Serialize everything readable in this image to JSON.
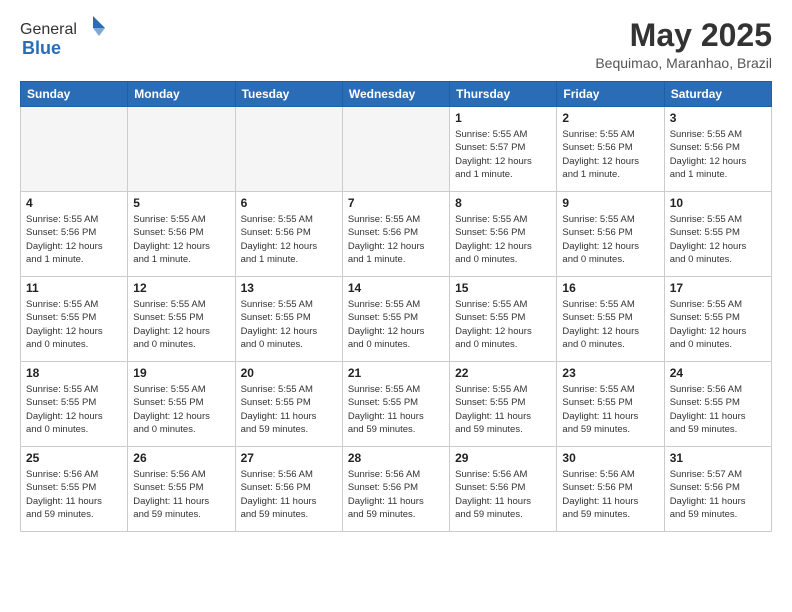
{
  "header": {
    "logo_general": "General",
    "logo_blue": "Blue",
    "title": "May 2025",
    "location": "Bequimao, Maranhao, Brazil"
  },
  "weekdays": [
    "Sunday",
    "Monday",
    "Tuesday",
    "Wednesday",
    "Thursday",
    "Friday",
    "Saturday"
  ],
  "weeks": [
    [
      {
        "day": "",
        "info": ""
      },
      {
        "day": "",
        "info": ""
      },
      {
        "day": "",
        "info": ""
      },
      {
        "day": "",
        "info": ""
      },
      {
        "day": "1",
        "info": "Sunrise: 5:55 AM\nSunset: 5:57 PM\nDaylight: 12 hours\nand 1 minute."
      },
      {
        "day": "2",
        "info": "Sunrise: 5:55 AM\nSunset: 5:56 PM\nDaylight: 12 hours\nand 1 minute."
      },
      {
        "day": "3",
        "info": "Sunrise: 5:55 AM\nSunset: 5:56 PM\nDaylight: 12 hours\nand 1 minute."
      }
    ],
    [
      {
        "day": "4",
        "info": "Sunrise: 5:55 AM\nSunset: 5:56 PM\nDaylight: 12 hours\nand 1 minute."
      },
      {
        "day": "5",
        "info": "Sunrise: 5:55 AM\nSunset: 5:56 PM\nDaylight: 12 hours\nand 1 minute."
      },
      {
        "day": "6",
        "info": "Sunrise: 5:55 AM\nSunset: 5:56 PM\nDaylight: 12 hours\nand 1 minute."
      },
      {
        "day": "7",
        "info": "Sunrise: 5:55 AM\nSunset: 5:56 PM\nDaylight: 12 hours\nand 1 minute."
      },
      {
        "day": "8",
        "info": "Sunrise: 5:55 AM\nSunset: 5:56 PM\nDaylight: 12 hours\nand 0 minutes."
      },
      {
        "day": "9",
        "info": "Sunrise: 5:55 AM\nSunset: 5:56 PM\nDaylight: 12 hours\nand 0 minutes."
      },
      {
        "day": "10",
        "info": "Sunrise: 5:55 AM\nSunset: 5:55 PM\nDaylight: 12 hours\nand 0 minutes."
      }
    ],
    [
      {
        "day": "11",
        "info": "Sunrise: 5:55 AM\nSunset: 5:55 PM\nDaylight: 12 hours\nand 0 minutes."
      },
      {
        "day": "12",
        "info": "Sunrise: 5:55 AM\nSunset: 5:55 PM\nDaylight: 12 hours\nand 0 minutes."
      },
      {
        "day": "13",
        "info": "Sunrise: 5:55 AM\nSunset: 5:55 PM\nDaylight: 12 hours\nand 0 minutes."
      },
      {
        "day": "14",
        "info": "Sunrise: 5:55 AM\nSunset: 5:55 PM\nDaylight: 12 hours\nand 0 minutes."
      },
      {
        "day": "15",
        "info": "Sunrise: 5:55 AM\nSunset: 5:55 PM\nDaylight: 12 hours\nand 0 minutes."
      },
      {
        "day": "16",
        "info": "Sunrise: 5:55 AM\nSunset: 5:55 PM\nDaylight: 12 hours\nand 0 minutes."
      },
      {
        "day": "17",
        "info": "Sunrise: 5:55 AM\nSunset: 5:55 PM\nDaylight: 12 hours\nand 0 minutes."
      }
    ],
    [
      {
        "day": "18",
        "info": "Sunrise: 5:55 AM\nSunset: 5:55 PM\nDaylight: 12 hours\nand 0 minutes."
      },
      {
        "day": "19",
        "info": "Sunrise: 5:55 AM\nSunset: 5:55 PM\nDaylight: 12 hours\nand 0 minutes."
      },
      {
        "day": "20",
        "info": "Sunrise: 5:55 AM\nSunset: 5:55 PM\nDaylight: 11 hours\nand 59 minutes."
      },
      {
        "day": "21",
        "info": "Sunrise: 5:55 AM\nSunset: 5:55 PM\nDaylight: 11 hours\nand 59 minutes."
      },
      {
        "day": "22",
        "info": "Sunrise: 5:55 AM\nSunset: 5:55 PM\nDaylight: 11 hours\nand 59 minutes."
      },
      {
        "day": "23",
        "info": "Sunrise: 5:55 AM\nSunset: 5:55 PM\nDaylight: 11 hours\nand 59 minutes."
      },
      {
        "day": "24",
        "info": "Sunrise: 5:56 AM\nSunset: 5:55 PM\nDaylight: 11 hours\nand 59 minutes."
      }
    ],
    [
      {
        "day": "25",
        "info": "Sunrise: 5:56 AM\nSunset: 5:55 PM\nDaylight: 11 hours\nand 59 minutes."
      },
      {
        "day": "26",
        "info": "Sunrise: 5:56 AM\nSunset: 5:55 PM\nDaylight: 11 hours\nand 59 minutes."
      },
      {
        "day": "27",
        "info": "Sunrise: 5:56 AM\nSunset: 5:56 PM\nDaylight: 11 hours\nand 59 minutes."
      },
      {
        "day": "28",
        "info": "Sunrise: 5:56 AM\nSunset: 5:56 PM\nDaylight: 11 hours\nand 59 minutes."
      },
      {
        "day": "29",
        "info": "Sunrise: 5:56 AM\nSunset: 5:56 PM\nDaylight: 11 hours\nand 59 minutes."
      },
      {
        "day": "30",
        "info": "Sunrise: 5:56 AM\nSunset: 5:56 PM\nDaylight: 11 hours\nand 59 minutes."
      },
      {
        "day": "31",
        "info": "Sunrise: 5:57 AM\nSunset: 5:56 PM\nDaylight: 11 hours\nand 59 minutes."
      }
    ]
  ]
}
